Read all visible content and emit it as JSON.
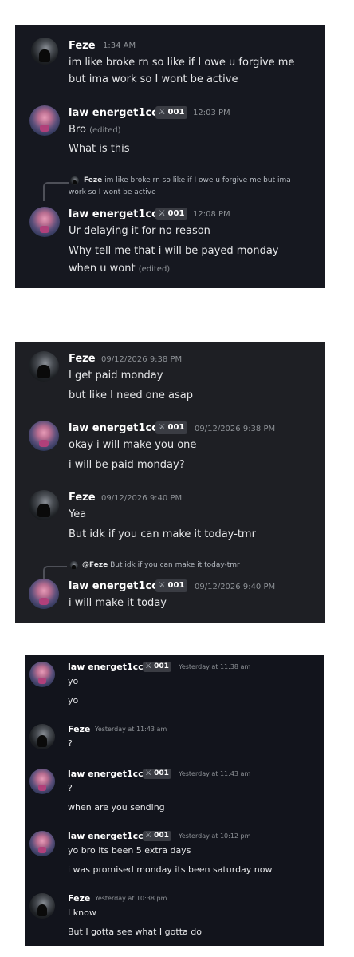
{
  "users": {
    "feze": "Feze",
    "law": "law energet1cc"
  },
  "badge": {
    "icon": "sword-icon",
    "tag": "001"
  },
  "edited_label": "(edited)",
  "screenshot1": {
    "m1": {
      "time": "1:34 AM",
      "line1": "im like broke rn so like if I owe u forgive me",
      "line2": "but ima work so I wont be active"
    },
    "m2": {
      "time": "12:03 PM",
      "line1": "Bro",
      "line2": "What is this"
    },
    "reply": {
      "author": "Feze",
      "text1": "im like broke rn so like if I owe u forgive me but ima",
      "text2": "work so I wont be active"
    },
    "m3": {
      "time": "12:08 PM",
      "line1": "Ur delaying it for no reason",
      "line2": "Why tell me that i will be payed monday",
      "line3": "when u wont"
    }
  },
  "screenshot2": {
    "m1": {
      "time": "09/12/2026 9:38 PM",
      "line1": "I get paid monday",
      "line2": "but like I need one asap"
    },
    "m2": {
      "time": "09/12/2026 9:38 PM",
      "line1": "okay i will make you one",
      "line2": "i will be paid monday?"
    },
    "m3": {
      "time": "09/12/2026 9:40 PM",
      "line1": "Yea",
      "line2": "But idk if you can make it today-tmr"
    },
    "reply": {
      "author": "@Feze",
      "text": "But idk if you can make it today-tmr"
    },
    "m4": {
      "time": "09/12/2026 9:40 PM",
      "line1": "i will make it today"
    }
  },
  "screenshot3": {
    "m1": {
      "time": "Yesterday at 11:38 am",
      "line1": "yo",
      "line2": "yo"
    },
    "m2": {
      "time": "Yesterday at 11:43 am",
      "line1": "?"
    },
    "m3": {
      "time": "Yesterday at 11:43 am",
      "line1": "?",
      "line2": "when are you sending"
    },
    "m4": {
      "time": "Yesterday at 10:12 pm",
      "line1": "yo bro its been 5 extra days",
      "line2": "i was promised monday its been saturday now"
    },
    "m5": {
      "time": "Yesterday at 10:38 pm",
      "line1": "I know",
      "line2": "But I gotta see what I gotta do"
    }
  }
}
